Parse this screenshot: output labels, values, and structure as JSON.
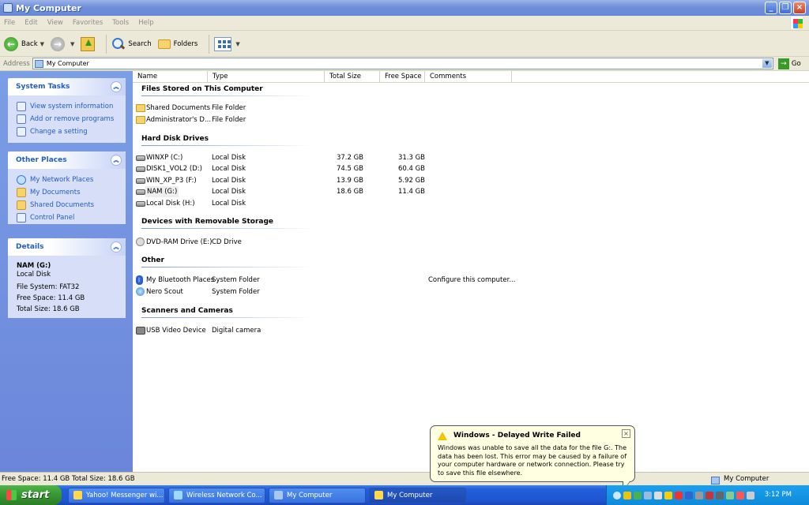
{
  "window": {
    "title": "My Computer"
  },
  "menu": [
    "File",
    "Edit",
    "View",
    "Favorites",
    "Tools",
    "Help"
  ],
  "toolbar": {
    "back_label": "Back",
    "search_label": "Search",
    "folders_label": "Folders"
  },
  "address": {
    "label": "Address",
    "value": "My Computer",
    "go_label": "Go"
  },
  "left_panels": {
    "system_tasks": {
      "title": "System Tasks",
      "items": [
        "View system information",
        "Add or remove programs",
        "Change a setting"
      ]
    },
    "other_places": {
      "title": "Other Places",
      "items": [
        "My Network Places",
        "My Documents",
        "Shared Documents",
        "Control Panel"
      ]
    },
    "details": {
      "title": "Details",
      "name": "NAM (G:)",
      "type": "Local Disk",
      "filesystem": "File System: FAT32",
      "free": "Free Space: 11.4 GB",
      "total": "Total Size: 18.6 GB"
    }
  },
  "columns": [
    "Name",
    "Type",
    "Total Size",
    "Free Space",
    "Comments"
  ],
  "groups": [
    {
      "title": "Files Stored on This Computer",
      "items": [
        {
          "name": "Shared Documents",
          "type": "File Folder",
          "icon": "folder-icon"
        },
        {
          "name": "Administrator's D...",
          "type": "File Folder",
          "icon": "folder-icon"
        }
      ]
    },
    {
      "title": "Hard Disk Drives",
      "items": [
        {
          "name": "WINXP (C:)",
          "type": "Local Disk",
          "total": "37.2 GB",
          "free": "31.3 GB",
          "icon": "hard-disk-icon"
        },
        {
          "name": "DISK1_VOL2 (D:)",
          "type": "Local Disk",
          "total": "74.5 GB",
          "free": "60.4 GB",
          "icon": "hard-disk-icon"
        },
        {
          "name": "WIN_XP_P3 (F:)",
          "type": "Local Disk",
          "total": "13.9 GB",
          "free": "5.92 GB",
          "icon": "hard-disk-icon"
        },
        {
          "name": "NAM (G:)",
          "type": "Local Disk",
          "total": "18.6 GB",
          "free": "11.4 GB",
          "icon": "hard-disk-icon"
        },
        {
          "name": "Local Disk (H:)",
          "type": "Local Disk",
          "icon": "hard-disk-icon"
        }
      ]
    },
    {
      "title": "Devices with Removable Storage",
      "items": [
        {
          "name": "DVD-RAM Drive (E:)",
          "type": "CD Drive",
          "icon": "cd-drive-icon"
        }
      ]
    },
    {
      "title": "Other",
      "items": [
        {
          "name": "My Bluetooth Places",
          "type": "System Folder",
          "comment": "Configure this computer...",
          "icon": "bluetooth-icon"
        },
        {
          "name": "Nero Scout",
          "type": "System Folder",
          "icon": "globe-icon"
        }
      ]
    },
    {
      "title": "Scanners and Cameras",
      "items": [
        {
          "name": "USB Video Device",
          "type": "Digital camera",
          "icon": "camera-icon"
        }
      ]
    }
  ],
  "statusbar": {
    "left": "Free Space: 11.4 GB Total Size: 18.6 GB",
    "right": "My Computer"
  },
  "balloon": {
    "title": "Windows - Delayed Write Failed",
    "message": "Windows was unable to save all the data for the file G:. The data has been lost. This error may be caused by a failure of your computer hardware or network connection. Please try to save this file elsewhere."
  },
  "taskbar": {
    "start_label": "start",
    "tasks": [
      "Yahoo! Messenger wi...",
      "Wireless Network Co...",
      "My Computer",
      "My Computer"
    ],
    "clock": "3:12 PM"
  }
}
